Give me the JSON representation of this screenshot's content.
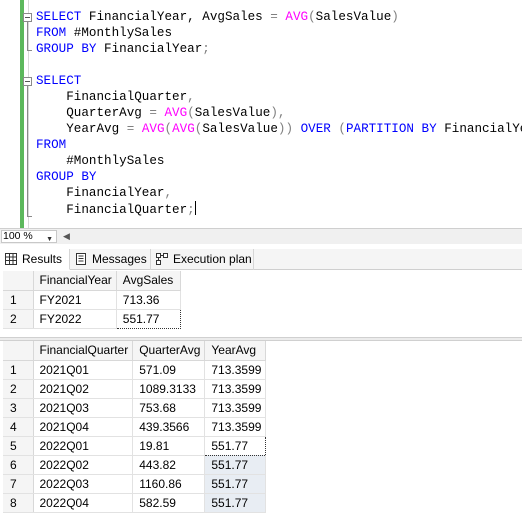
{
  "editor": {
    "lines": [
      [
        {
          "t": "SELECT",
          "c": "kw"
        },
        {
          "t": " FinancialYear, AvgSales "
        },
        {
          "t": "=",
          "c": "op"
        },
        {
          "t": " "
        },
        {
          "t": "AVG",
          "c": "fn"
        },
        {
          "t": "(",
          "c": "op"
        },
        {
          "t": "SalesValue"
        },
        {
          "t": ")",
          "c": "op"
        }
      ],
      [
        {
          "t": "FROM",
          "c": "kw"
        },
        {
          "t": " #MonthlySales"
        }
      ],
      [
        {
          "t": "GROUP BY",
          "c": "kw"
        },
        {
          "t": " FinancialYear"
        },
        {
          "t": ";",
          "c": "op"
        }
      ],
      [],
      [
        {
          "t": "SELECT",
          "c": "kw"
        }
      ],
      [
        {
          "t": "    FinancialQuarter"
        },
        {
          "t": ",",
          "c": "op"
        }
      ],
      [
        {
          "t": "    QuarterAvg "
        },
        {
          "t": "=",
          "c": "op"
        },
        {
          "t": " "
        },
        {
          "t": "AVG",
          "c": "fn"
        },
        {
          "t": "(",
          "c": "op"
        },
        {
          "t": "SalesValue"
        },
        {
          "t": "),",
          "c": "op"
        }
      ],
      [
        {
          "t": "    YearAvg "
        },
        {
          "t": "=",
          "c": "op"
        },
        {
          "t": " "
        },
        {
          "t": "AVG",
          "c": "fn"
        },
        {
          "t": "(",
          "c": "op"
        },
        {
          "t": "AVG",
          "c": "fn"
        },
        {
          "t": "(",
          "c": "op"
        },
        {
          "t": "SalesValue"
        },
        {
          "t": "))",
          "c": "op"
        },
        {
          "t": " "
        },
        {
          "t": "OVER",
          "c": "kw"
        },
        {
          "t": " "
        },
        {
          "t": "(",
          "c": "op"
        },
        {
          "t": "PARTITION BY",
          "c": "kw"
        },
        {
          "t": " FinancialYear"
        },
        {
          "t": ")",
          "c": "op"
        }
      ],
      [
        {
          "t": "FROM",
          "c": "kw"
        }
      ],
      [
        {
          "t": "    #MonthlySales"
        }
      ],
      [
        {
          "t": "GROUP BY",
          "c": "kw"
        }
      ],
      [
        {
          "t": "    FinancialYear"
        },
        {
          "t": ",",
          "c": "op"
        }
      ],
      [
        {
          "t": "    FinancialQuarter"
        },
        {
          "t": ";",
          "c": "op"
        }
      ]
    ]
  },
  "zoom": {
    "value": "100 %"
  },
  "tabs": [
    {
      "label": "Results",
      "icon": "grid-icon"
    },
    {
      "label": "Messages",
      "icon": "messages-icon"
    },
    {
      "label": "Execution plan",
      "icon": "execution-plan-icon"
    }
  ],
  "grid1": {
    "columns": [
      "FinancialYear",
      "AvgSales"
    ],
    "rows": [
      {
        "num": "1",
        "cells": [
          "FY2021",
          "713.36"
        ]
      },
      {
        "num": "2",
        "cells": [
          "FY2022",
          "551.77"
        ]
      }
    ]
  },
  "grid2": {
    "columns": [
      "FinancialQuarter",
      "QuarterAvg",
      "YearAvg"
    ],
    "rows": [
      {
        "num": "1",
        "cells": [
          "2021Q01",
          "571.09",
          "713.3599"
        ]
      },
      {
        "num": "2",
        "cells": [
          "2021Q02",
          "1089.3133",
          "713.3599"
        ]
      },
      {
        "num": "3",
        "cells": [
          "2021Q03",
          "753.68",
          "713.3599"
        ]
      },
      {
        "num": "4",
        "cells": [
          "2021Q04",
          "439.3566",
          "713.3599"
        ]
      },
      {
        "num": "5",
        "cells": [
          "2022Q01",
          "19.81",
          "551.77"
        ]
      },
      {
        "num": "6",
        "cells": [
          "2022Q02",
          "443.82",
          "551.77"
        ]
      },
      {
        "num": "7",
        "cells": [
          "2022Q03",
          "1160.86",
          "551.77"
        ]
      },
      {
        "num": "8",
        "cells": [
          "2022Q04",
          "582.59",
          "551.77"
        ]
      }
    ]
  }
}
